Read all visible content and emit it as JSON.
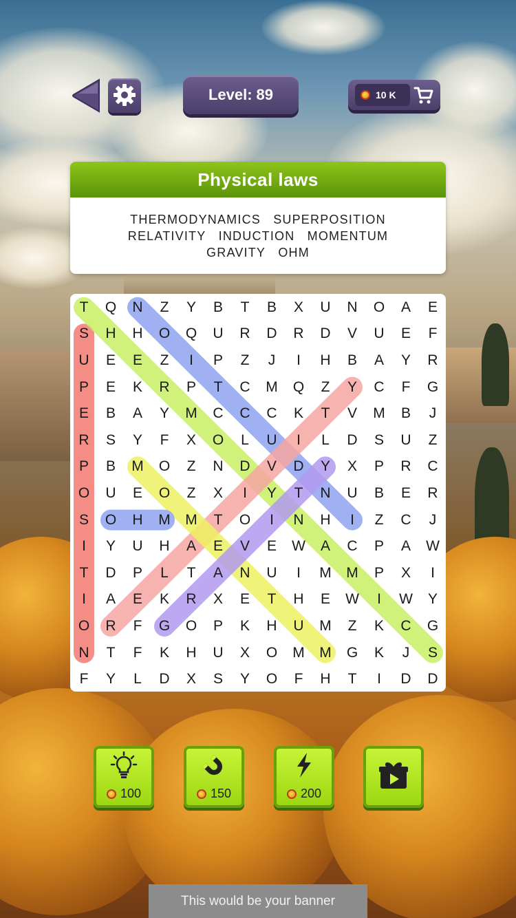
{
  "header": {
    "level_label": "Level:",
    "level_value": "89",
    "coins": "10 K"
  },
  "category": {
    "title": "Physical laws",
    "words_line1": [
      "THERMODYNAMICS",
      "SUPERPOSITION"
    ],
    "words_line2": [
      "RELATIVITY",
      "INDUCTION",
      "MOMENTUM"
    ],
    "words_line3": [
      "GRAVITY",
      "OHM"
    ]
  },
  "grid": {
    "rows": [
      "TQNZYBTBXUNOAE",
      "SHHOQURDRDVUEF",
      "UEEZIPZJIHBAYR",
      "PEKRPTCMQZYCFG",
      "EBAYMCCCKTVMBJ",
      "RSYFXOLUILDSUZ",
      "PBMOZNDVDYXPRC",
      "OUEOZXIYTNUBER",
      "SOHMMTOINHIZCJ",
      "IYUHAEVEWACPAW",
      "TDPLTANUIMMPXI",
      "IAEKRXETHEWIWY",
      "ORFGOPKHUMZKCG",
      "NTFKHUXOMMGKJS",
      "FYLDXSYOFHTIDD"
    ],
    "found": [
      {
        "word": "SUPERPOSITION",
        "color": "#f27a72",
        "from": [
          1,
          0
        ],
        "to": [
          13,
          0
        ]
      },
      {
        "word": "THERMODYNAMICS",
        "color": "#c8ef63",
        "from": [
          0,
          0
        ],
        "to": [
          13,
          13
        ]
      },
      {
        "word": "INDUCTION",
        "color": "#8fa4f0",
        "from": [
          0,
          2
        ],
        "to": [
          8,
          10
        ]
      },
      {
        "word": "RELATIVITY",
        "color": "#f6a6a2",
        "from": [
          12,
          1
        ],
        "to": [
          3,
          10
        ]
      },
      {
        "word": "MOMENTUM",
        "color": "#eef262",
        "from": [
          6,
          2
        ],
        "to": [
          13,
          9
        ]
      },
      {
        "word": "GRAVITY",
        "color": "#b29af0",
        "from": [
          12,
          3
        ],
        "to": [
          6,
          9
        ]
      },
      {
        "word": "OHM",
        "color": "#8fa4f0",
        "from": [
          8,
          1
        ],
        "to": [
          8,
          3
        ]
      }
    ]
  },
  "boosters": [
    {
      "name": "hint",
      "icon": "lightbulb-icon",
      "cost": "100"
    },
    {
      "name": "magnet",
      "icon": "magnet-icon",
      "cost": "150"
    },
    {
      "name": "lightning",
      "icon": "lightning-icon",
      "cost": "200"
    },
    {
      "name": "video",
      "icon": "gift-video-icon",
      "cost": ""
    }
  ],
  "banner": {
    "text": "This would be your banner"
  }
}
